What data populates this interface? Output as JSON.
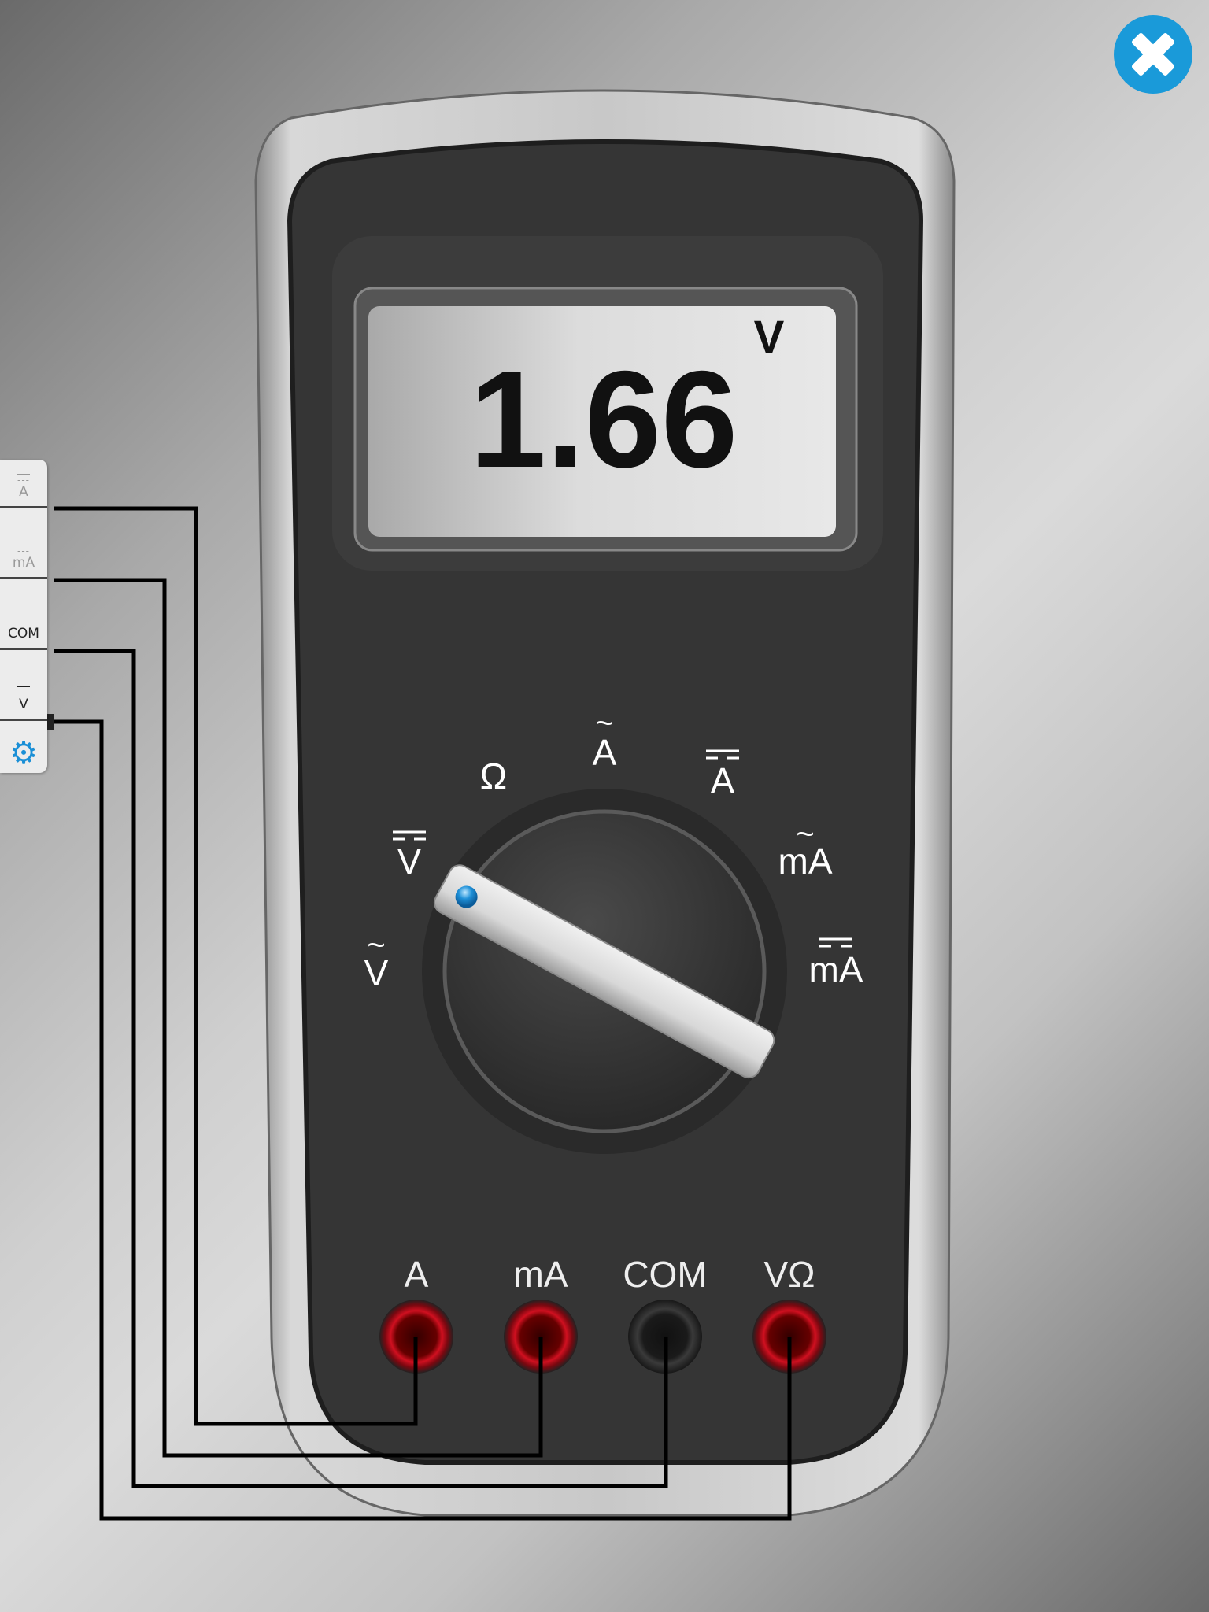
{
  "display": {
    "reading": "1.66",
    "unit": "V"
  },
  "dial": {
    "labels": {
      "ohm": "Ω",
      "ac_amp": "A",
      "dc_amp": "A",
      "ac_milliamp": "mA",
      "dc_milliamp": "mA",
      "dc_volt": "V",
      "ac_volt": "V"
    },
    "ac_symbol": "~",
    "dc_symbol": "⎓",
    "selected": "dc_volt"
  },
  "jacks": [
    {
      "label": "A",
      "color": "red"
    },
    {
      "label": "mA",
      "color": "red"
    },
    {
      "label": "COM",
      "color": "black"
    },
    {
      "label": "VΩ",
      "color": "red"
    }
  ],
  "sidebar": {
    "tabs": [
      {
        "symbol": "---",
        "label": "A"
      },
      {
        "symbol": "---",
        "label": "mA"
      },
      {
        "label": "COM"
      },
      {
        "symbol": "---",
        "label": "V"
      }
    ],
    "settings_icon": "gear-icon"
  },
  "close_icon": "close-icon",
  "colors": {
    "accent": "#1a9ad9",
    "jack_red": "#c0101a",
    "body": "#333333"
  }
}
